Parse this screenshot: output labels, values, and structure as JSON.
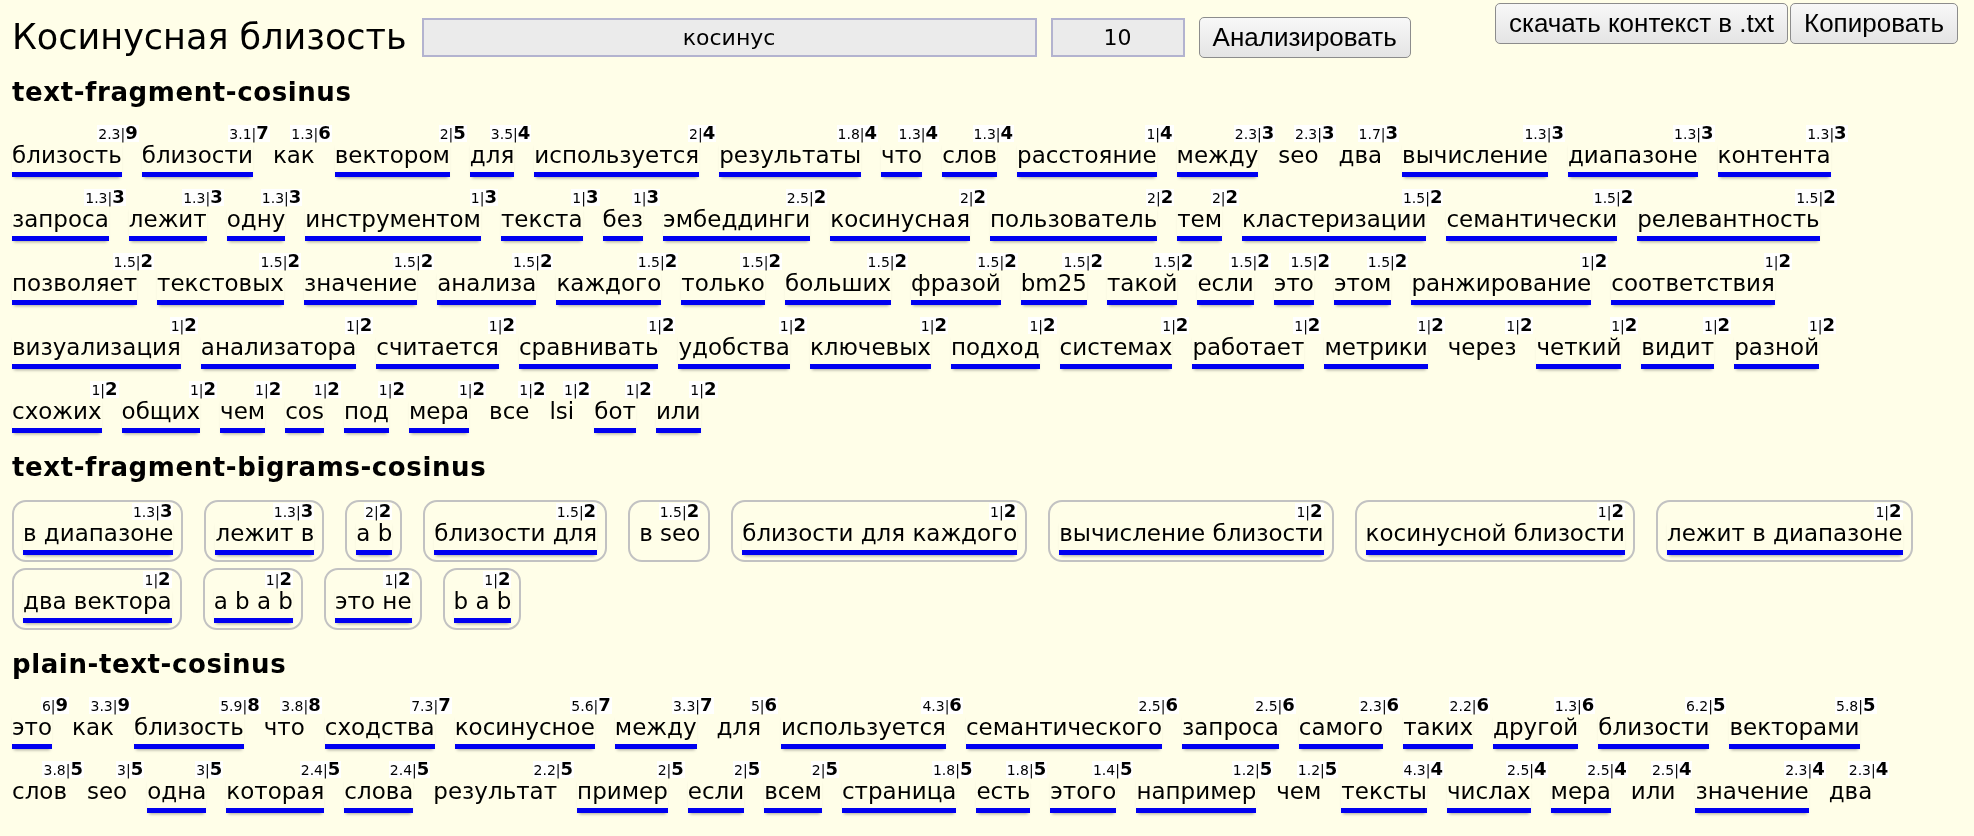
{
  "header": {
    "title": "Косинусная близость",
    "query_field": {
      "value": "косинус"
    },
    "count_field": {
      "value": "10"
    },
    "analyze_button": "Анализировать",
    "download_button": "скачать контекст в .txt",
    "copy_button": "Копировать"
  },
  "sections": [
    {
      "title": "text-fragment-cosinus",
      "kind": "words",
      "items": [
        {
          "text": "близость",
          "note": "2.3|**9**",
          "underlined": true
        },
        {
          "text": "близости",
          "note": "3.1|**7**",
          "underlined": true
        },
        {
          "text": "как",
          "note": "1.3|**6**",
          "underlined": false
        },
        {
          "text": "вектором",
          "note": "2|**5**",
          "underlined": true
        },
        {
          "text": "для",
          "note": "3.5|**4**",
          "underlined": true
        },
        {
          "text": "используется",
          "note": "2|**4**",
          "underlined": true
        },
        {
          "text": "результаты",
          "note": "1.8|**4**",
          "underlined": true
        },
        {
          "text": "что",
          "note": "1.3|**4**",
          "underlined": true
        },
        {
          "text": "слов",
          "note": "1.3|**4**",
          "underlined": true
        },
        {
          "text": "расстояние",
          "note": "1|**4**",
          "underlined": true
        },
        {
          "text": "между",
          "note": "2.3|**3**",
          "underlined": true
        },
        {
          "text": "seo",
          "note": "2.3|**3**",
          "underlined": false
        },
        {
          "text": "два",
          "note": "1.7|**3**",
          "underlined": false
        },
        {
          "text": "вычисление",
          "note": "1.3|**3**",
          "underlined": true
        },
        {
          "text": "диапазоне",
          "note": "1.3|**3**",
          "underlined": true
        },
        {
          "text": "контента",
          "note": "1.3|**3**",
          "underlined": true
        },
        {
          "text": "запроса",
          "note": "1.3|**3**",
          "underlined": true
        },
        {
          "text": "лежит",
          "note": "1.3|**3**",
          "underlined": true
        },
        {
          "text": "одну",
          "note": "1.3|**3**",
          "underlined": true
        },
        {
          "text": "инструментом",
          "note": "1|**3**",
          "underlined": true
        },
        {
          "text": "текста",
          "note": "1|**3**",
          "underlined": true
        },
        {
          "text": "без",
          "note": "1|**3**",
          "underlined": true
        },
        {
          "text": "эмбеддинги",
          "note": "2.5|**2**",
          "underlined": true
        },
        {
          "text": "косинусная",
          "note": "2|**2**",
          "underlined": true
        },
        {
          "text": "пользователь",
          "note": "2|**2**",
          "underlined": true
        },
        {
          "text": "тем",
          "note": "2|**2**",
          "underlined": true
        },
        {
          "text": "кластеризации",
          "note": "1.5|**2**",
          "underlined": true
        },
        {
          "text": "семантически",
          "note": "1.5|**2**",
          "underlined": true
        },
        {
          "text": "релевантность",
          "note": "1.5|**2**",
          "underlined": true
        },
        {
          "text": "позволяет",
          "note": "1.5|**2**",
          "underlined": true
        },
        {
          "text": "текстовых",
          "note": "1.5|**2**",
          "underlined": true
        },
        {
          "text": "значение",
          "note": "1.5|**2**",
          "underlined": true
        },
        {
          "text": "анализа",
          "note": "1.5|**2**",
          "underlined": true
        },
        {
          "text": "каждого",
          "note": "1.5|**2**",
          "underlined": true
        },
        {
          "text": "только",
          "note": "1.5|**2**",
          "underlined": true
        },
        {
          "text": "больших",
          "note": "1.5|**2**",
          "underlined": true
        },
        {
          "text": "фразой",
          "note": "1.5|**2**",
          "underlined": true
        },
        {
          "text": "bm25",
          "note": "1.5|**2**",
          "underlined": true
        },
        {
          "text": "такой",
          "note": "1.5|**2**",
          "underlined": true
        },
        {
          "text": "если",
          "note": "1.5|**2**",
          "underlined": true
        },
        {
          "text": "это",
          "note": "1.5|**2**",
          "underlined": true
        },
        {
          "text": "этом",
          "note": "1.5|**2**",
          "underlined": true
        },
        {
          "text": "ранжирование",
          "note": "1|**2**",
          "underlined": true
        },
        {
          "text": "соответствия",
          "note": "1|**2**",
          "underlined": true
        },
        {
          "text": "визуализация",
          "note": "1|**2**",
          "underlined": true
        },
        {
          "text": "анализатора",
          "note": "1|**2**",
          "underlined": true
        },
        {
          "text": "считается",
          "note": "1|**2**",
          "underlined": true
        },
        {
          "text": "сравнивать",
          "note": "1|**2**",
          "underlined": true
        },
        {
          "text": "удобства",
          "note": "1|**2**",
          "underlined": true
        },
        {
          "text": "ключевых",
          "note": "1|**2**",
          "underlined": true
        },
        {
          "text": "подход",
          "note": "1|**2**",
          "underlined": true
        },
        {
          "text": "системах",
          "note": "1|**2**",
          "underlined": true
        },
        {
          "text": "работает",
          "note": "1|**2**",
          "underlined": true
        },
        {
          "text": "метрики",
          "note": "1|**2**",
          "underlined": true
        },
        {
          "text": "через",
          "note": "1|**2**",
          "underlined": false
        },
        {
          "text": "четкий",
          "note": "1|**2**",
          "underlined": true
        },
        {
          "text": "видит",
          "note": "1|**2**",
          "underlined": true
        },
        {
          "text": "разной",
          "note": "1|**2**",
          "underlined": true
        },
        {
          "text": "схожих",
          "note": "1|**2**",
          "underlined": true
        },
        {
          "text": "общих",
          "note": "1|**2**",
          "underlined": true
        },
        {
          "text": "чем",
          "note": "1|**2**",
          "underlined": true
        },
        {
          "text": "cos",
          "note": "1|**2**",
          "underlined": true
        },
        {
          "text": "под",
          "note": "1|**2**",
          "underlined": true
        },
        {
          "text": "мера",
          "note": "1|**2**",
          "underlined": true
        },
        {
          "text": "все",
          "note": "1|**2**",
          "underlined": false
        },
        {
          "text": "lsi",
          "note": "1|**2**",
          "underlined": false
        },
        {
          "text": "бот",
          "note": "1|**2**",
          "underlined": true
        },
        {
          "text": "или",
          "note": "1|**2**",
          "underlined": true
        }
      ]
    },
    {
      "title": "text-fragment-bigrams-cosinus",
      "kind": "chips",
      "items": [
        {
          "text": "в диапазоне",
          "note": "1.3|**3**",
          "underlined": true
        },
        {
          "text": "лежит в",
          "note": "1.3|**3**",
          "underlined": true
        },
        {
          "text": "a b",
          "note": "2|**2**",
          "underlined": true
        },
        {
          "text": "близости для",
          "note": "1.5|**2**",
          "underlined": true
        },
        {
          "text": "в seo",
          "note": "1.5|**2**",
          "underlined": false
        },
        {
          "text": "близости для каждого",
          "note": "1|**2**",
          "underlined": true
        },
        {
          "text": "вычисление близости",
          "note": "1|**2**",
          "underlined": true
        },
        {
          "text": "косинусной близости",
          "note": "1|**2**",
          "underlined": true
        },
        {
          "text": "лежит в диапазоне",
          "note": "1|**2**",
          "underlined": true
        },
        {
          "text": "два вектора",
          "note": "1|**2**",
          "underlined": true
        },
        {
          "text": "a b a b",
          "note": "1|**2**",
          "underlined": true
        },
        {
          "text": "это не",
          "note": "1|**2**",
          "underlined": true
        },
        {
          "text": "b a b",
          "note": "1|**2**",
          "underlined": true
        }
      ]
    },
    {
      "title": "plain-text-cosinus",
      "kind": "words",
      "items": [
        {
          "text": "это",
          "note": "6|**9**",
          "underlined": true
        },
        {
          "text": "как",
          "note": "3.3|**9**",
          "underlined": false
        },
        {
          "text": "близость",
          "note": "5.9|**8**",
          "underlined": true
        },
        {
          "text": "что",
          "note": "3.8|**8**",
          "underlined": false
        },
        {
          "text": "сходства",
          "note": "7.3|**7**",
          "underlined": true
        },
        {
          "text": "косинусное",
          "note": "5.6|**7**",
          "underlined": true
        },
        {
          "text": "между",
          "note": "3.3|**7**",
          "underlined": true
        },
        {
          "text": "для",
          "note": "5|**6**",
          "underlined": false
        },
        {
          "text": "используется",
          "note": "4.3|**6**",
          "underlined": true
        },
        {
          "text": "семантического",
          "note": "2.5|**6**",
          "underlined": true
        },
        {
          "text": "запроса",
          "note": "2.5|**6**",
          "underlined": true
        },
        {
          "text": "самого",
          "note": "2.3|**6**",
          "underlined": true
        },
        {
          "text": "таких",
          "note": "2.2|**6**",
          "underlined": true
        },
        {
          "text": "другой",
          "note": "1.3|**6**",
          "underlined": true
        },
        {
          "text": "близости",
          "note": "6.2|**5**",
          "underlined": true
        },
        {
          "text": "векторами",
          "note": "5.8|**5**",
          "underlined": true
        },
        {
          "text": "слов",
          "note": "3.8|**5**",
          "underlined": false
        },
        {
          "text": "seo",
          "note": "3|**5**",
          "underlined": false
        },
        {
          "text": "одна",
          "note": "3|**5**",
          "underlined": true
        },
        {
          "text": "которая",
          "note": "2.4|**5**",
          "underlined": true
        },
        {
          "text": "слова",
          "note": "2.4|**5**",
          "underlined": true
        },
        {
          "text": "результат",
          "note": "2.2|**5**",
          "underlined": false
        },
        {
          "text": "пример",
          "note": "2|**5**",
          "underlined": true
        },
        {
          "text": "если",
          "note": "2|**5**",
          "underlined": true
        },
        {
          "text": "всем",
          "note": "2|**5**",
          "underlined": true
        },
        {
          "text": "страница",
          "note": "1.8|**5**",
          "underlined": true
        },
        {
          "text": "есть",
          "note": "1.8|**5**",
          "underlined": true
        },
        {
          "text": "этого",
          "note": "1.4|**5**",
          "underlined": true
        },
        {
          "text": "например",
          "note": "1.2|**5**",
          "underlined": true
        },
        {
          "text": "чем",
          "note": "1.2|**5**",
          "underlined": false
        },
        {
          "text": "тексты",
          "note": "4.3|**4**",
          "underlined": true
        },
        {
          "text": "числах",
          "note": "2.5|**4**",
          "underlined": true
        },
        {
          "text": "мера",
          "note": "2.5|**4**",
          "underlined": true
        },
        {
          "text": "или",
          "note": "2.5|**4**",
          "underlined": false
        },
        {
          "text": "значение",
          "note": "2.3|**4**",
          "underlined": true
        },
        {
          "text": "два",
          "note": "2.3|**4**",
          "underlined": false
        }
      ]
    }
  ]
}
